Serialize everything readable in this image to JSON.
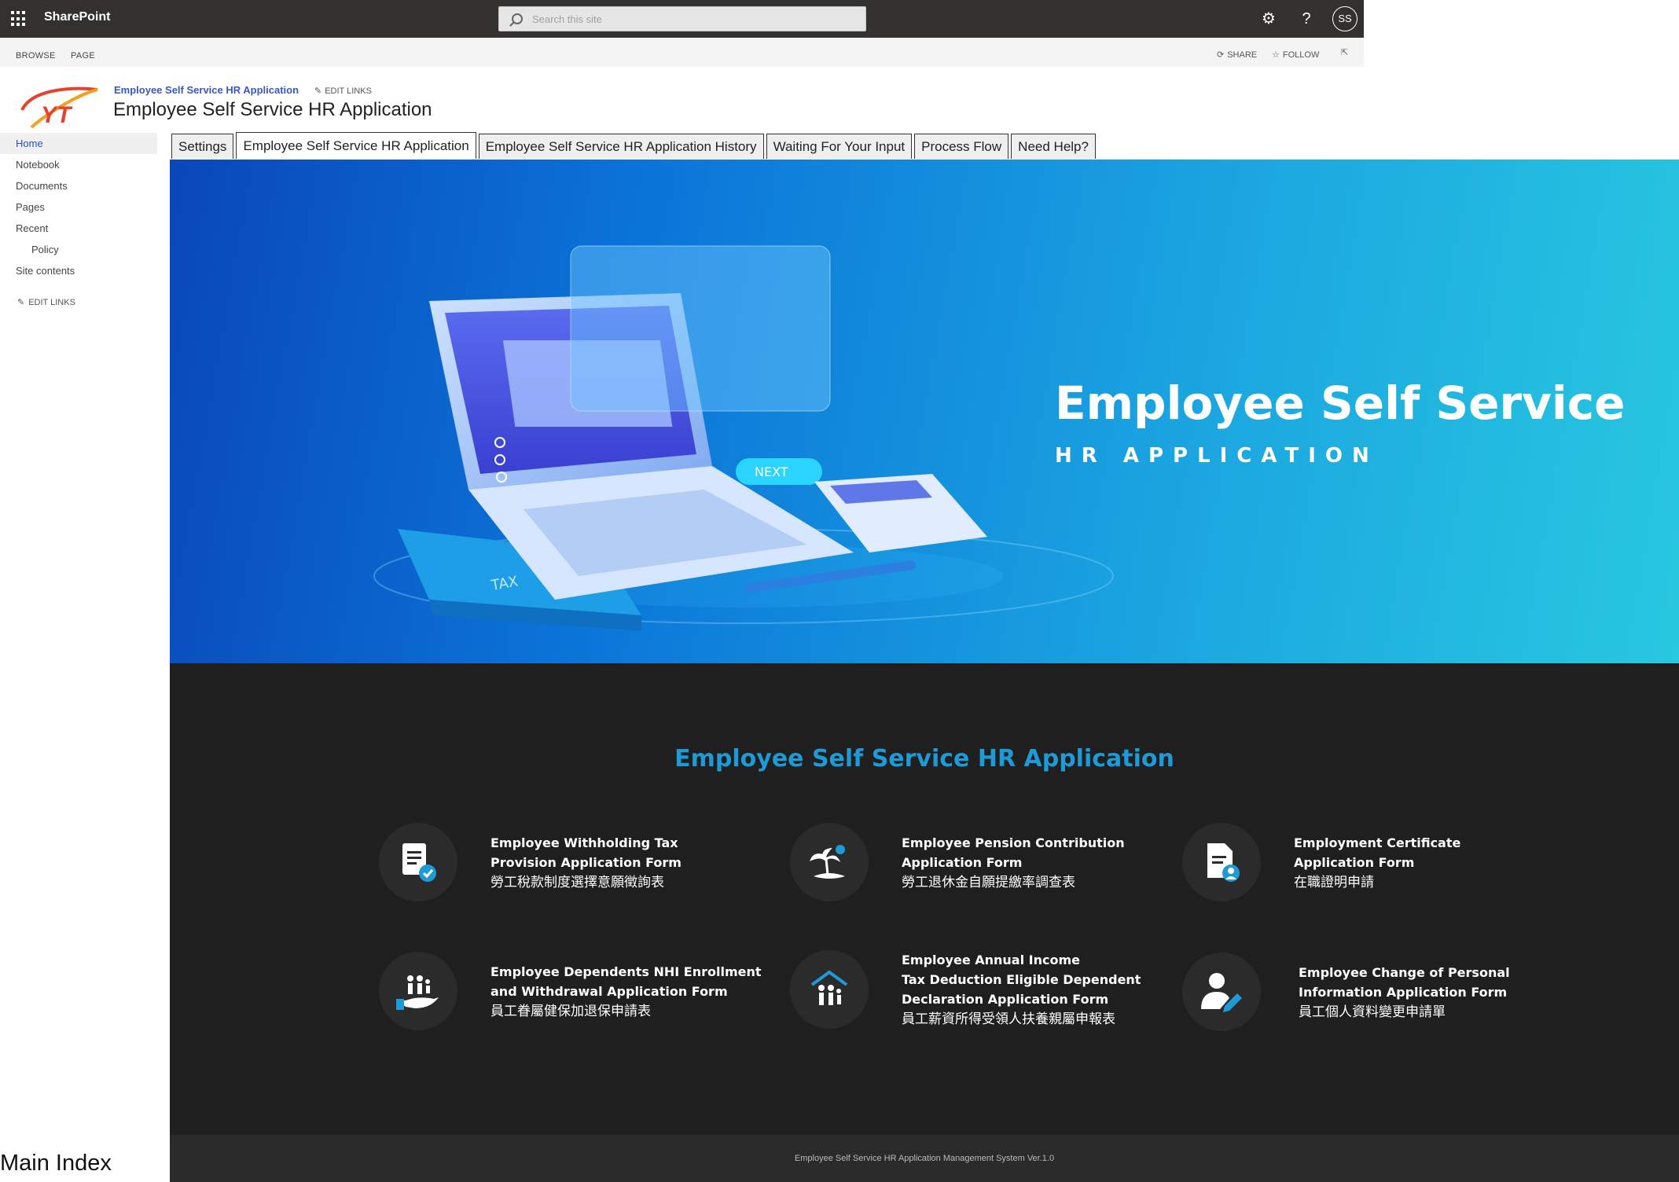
{
  "suitebar": {
    "brand": "SharePoint",
    "search_placeholder": "Search this site",
    "avatar": "SS"
  },
  "ribbon": {
    "browse": "BROWSE",
    "page": "PAGE",
    "share": "SHARE",
    "follow": "FOLLOW"
  },
  "site": {
    "link": "Employee Self Service HR Application",
    "edit_links": "EDIT LINKS",
    "title": "Employee Self Service HR Application",
    "logo_text": "YT"
  },
  "leftnav": {
    "items": [
      "Home",
      "Notebook",
      "Documents",
      "Pages",
      "Recent",
      "Policy",
      "Site contents"
    ],
    "edit_links": "EDIT LINKS"
  },
  "tabs": [
    "Settings",
    "Employee Self Service HR Application",
    "Employee Self Service HR Application History",
    "Waiting For Your Input",
    "Process Flow",
    "Need Help?"
  ],
  "hero": {
    "title": "Employee Self Service",
    "subtitle": "HR APPLICATION",
    "next_label": "NEXT",
    "tax_label": "TAX"
  },
  "section": {
    "title": "Employee Self Service HR Application",
    "cards": [
      {
        "en1": "Employee Withholding Tax",
        "en2": "Provision Application Form",
        "en3": "",
        "zh": "勞工稅款制度選擇意願徵詢表",
        "icon": "document-check-icon"
      },
      {
        "en1": "Employee Pension Contribution",
        "en2": "Application Form",
        "en3": "",
        "zh": "勞工退休金自願提繳率調查表",
        "icon": "island-sun-icon"
      },
      {
        "en1": "Employment Certificate",
        "en2": "Application Form",
        "en3": "",
        "zh": "在職證明申請",
        "icon": "document-person-icon"
      },
      {
        "en1": "Employee Dependents NHI Enrollment",
        "en2": "and Withdrawal Application Form",
        "en3": "",
        "zh": "員工眷屬健保加退保申請表",
        "icon": "family-hand-icon"
      },
      {
        "en1": "Employee Annual Income",
        "en2": "Tax Deduction Eligible Dependent",
        "en3": "Declaration Application Form",
        "zh": "員工薪資所得受領人扶養親屬申報表",
        "icon": "family-house-icon"
      },
      {
        "en1": "Employee Change of Personal",
        "en2": "Information Application Form",
        "en3": "",
        "zh": "員工個人資料變更申請單",
        "icon": "person-edit-icon"
      }
    ]
  },
  "footer": "Employee Self Service HR Application Management System Ver.1.0",
  "caption": "Main Index",
  "colors": {
    "suitebar": "#323130",
    "accent": "#1e9ad6",
    "dark_bg": "#1f1f1f",
    "link": "#3a58c4"
  }
}
